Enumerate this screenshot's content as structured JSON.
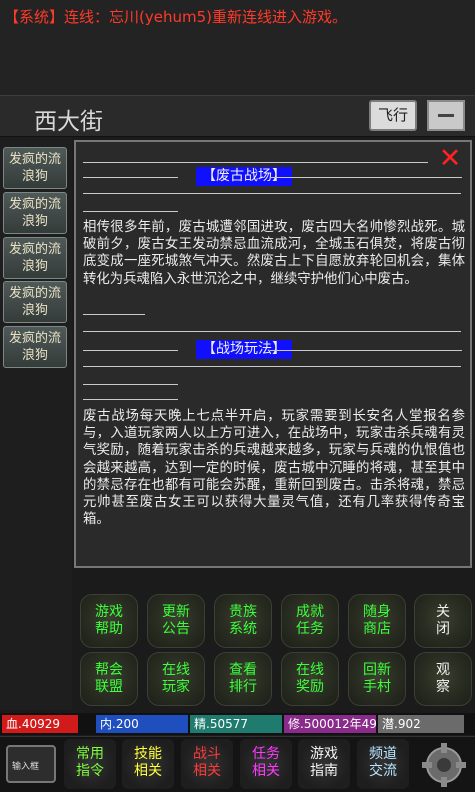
{
  "system": {
    "message": "【系统】连线：忘川(yehum5)重新连线进入游戏。"
  },
  "location": {
    "title": "西大街",
    "fly_label": "飞行"
  },
  "npcs": [
    "发疯的流浪狗",
    "发疯的流浪狗",
    "发疯的流浪狗",
    "发疯的流浪狗",
    "发疯的流浪狗"
  ],
  "panel": {
    "section1_title": "【废古战场】",
    "section1_text": "相传很多年前，废古城遭邻国进攻，废古四大名帅惨烈战死。城破前夕，废古女王发动禁忌血流成河，全城玉石俱焚，将废古彻底变成一座死城煞气冲天。然废古上下自愿放弃轮回机会，集体转化为兵魂陷入永世沉沦之中，继续守护他们心中废古。",
    "section2_title": "【战场玩法】",
    "section2_text": "废古战场每天晚上七点半开启，玩家需要到长安名人堂报名参与，入道玩家两人以上方可进入，在战场中，玩家击杀兵魂有灵气奖励，随着玩家击杀的兵魂越来越多，玩家与兵魂的仇恨值也会越来越高，达到一定的时候，废古城中沉睡的将魂，甚至其中的禁忌存在也都有可能会苏醒，重新回到废古。击杀将魂，禁忌元帅甚至废古女王可以获得大量灵气值，还有几率获得传奇宝箱。"
  },
  "menu": [
    {
      "line1": "游戏",
      "line2": "帮助",
      "color": "green"
    },
    {
      "line1": "更新",
      "line2": "公告",
      "color": "green"
    },
    {
      "line1": "贵族",
      "line2": "系统",
      "color": "green"
    },
    {
      "line1": "成就",
      "line2": "任务",
      "color": "green"
    },
    {
      "line1": "随身",
      "line2": "商店",
      "color": "green"
    },
    {
      "line1": "关",
      "line2": "闭",
      "color": "white"
    },
    {
      "line1": "帮会",
      "line2": "联盟",
      "color": "green"
    },
    {
      "line1": "在线",
      "line2": "玩家",
      "color": "green"
    },
    {
      "line1": "查看",
      "line2": "排行",
      "color": "green"
    },
    {
      "line1": "在线",
      "line2": "奖励",
      "color": "green"
    },
    {
      "line1": "回新",
      "line2": "手村",
      "color": "green"
    },
    {
      "line1": "观",
      "line2": "察",
      "color": "white"
    }
  ],
  "stats": {
    "hp": "血.40929",
    "mp": "内.200",
    "jing": "精.50577",
    "xiu": "修.500012年49",
    "qian": "潜.902",
    "colors": {
      "hp": "#d11a1a",
      "mp": "#1f4fbf",
      "jing": "#1f7b6e",
      "xiu": "#8a2a8a",
      "qian": "#6b6b6b"
    }
  },
  "bottom": {
    "input_label": "输入框",
    "buttons": [
      {
        "line1": "常用",
        "line2": "指令",
        "color": "#7dff3b"
      },
      {
        "line1": "技能",
        "line2": "相关",
        "color": "#ffff3a"
      },
      {
        "line1": "战斗",
        "line2": "相关",
        "color": "#ff3a3a"
      },
      {
        "line1": "任务",
        "line2": "相关",
        "color": "#ff3aff"
      },
      {
        "line1": "游戏",
        "line2": "指南",
        "color": "#f2f2f2"
      },
      {
        "line1": "频道",
        "line2": "交流",
        "color": "#b7e6ff"
      }
    ]
  }
}
